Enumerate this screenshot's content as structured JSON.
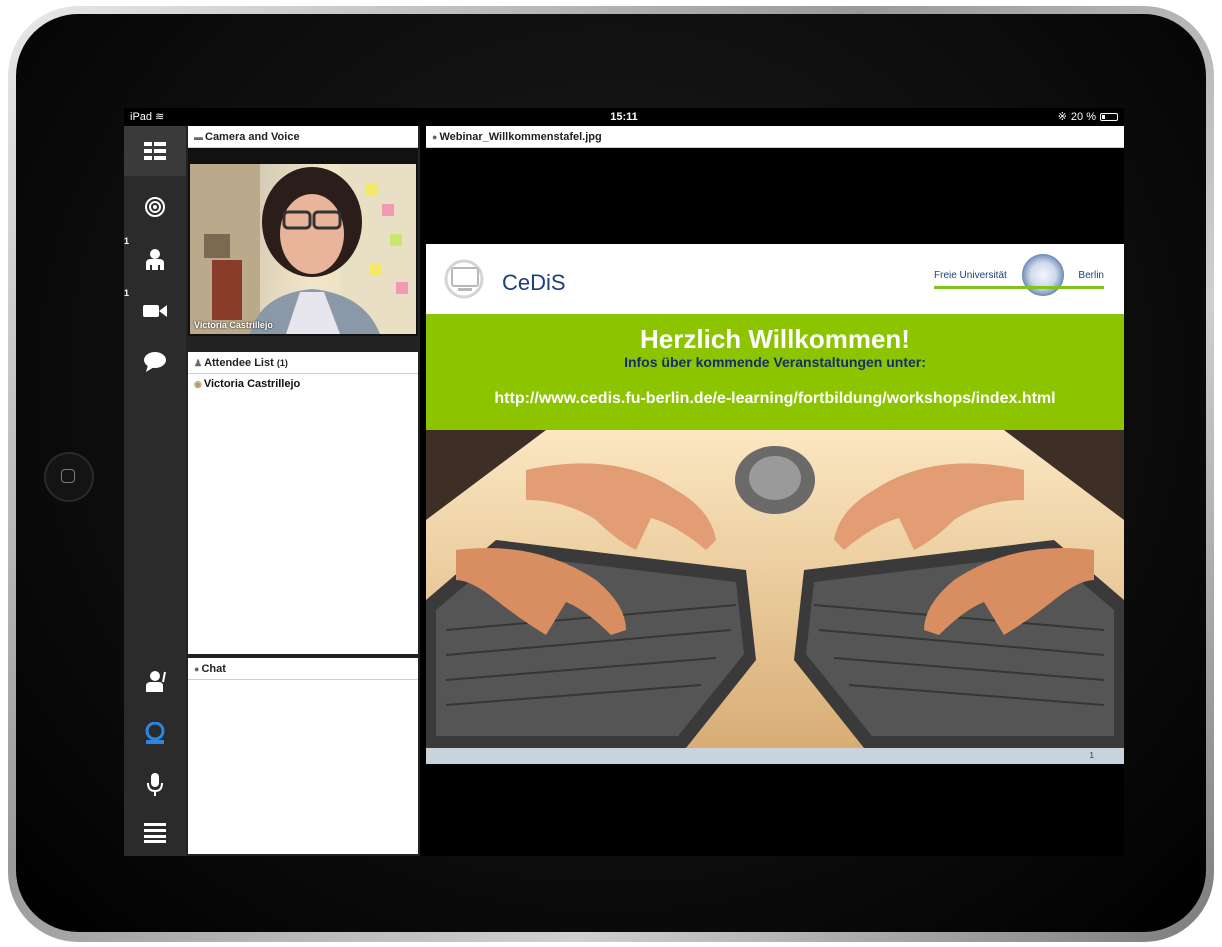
{
  "status_bar": {
    "device": "iPad",
    "time": "15:11",
    "battery": "20 %"
  },
  "sidebar": {
    "attendee_count": "1",
    "camera_count": "1"
  },
  "camera_panel": {
    "title": "Camera and Voice",
    "video_name": "Victoria Castrillejo"
  },
  "attendee_panel": {
    "title": "Attendee List",
    "count": "(1)",
    "attendees": [
      "Victoria Castrillejo"
    ]
  },
  "chat_panel": {
    "title": "Chat"
  },
  "main": {
    "file_title": "Webinar_Willkommenstafel.jpg",
    "slide": {
      "logo_text": "CeDiS",
      "university_left": "Freie Universität",
      "university_right": "Berlin",
      "headline": "Herzlich Willkommen!",
      "subline": "Infos über kommende Veranstaltungen unter:",
      "url": "http://www.cedis.fu-berlin.de/e-learning/fortbildung/workshops/index.html",
      "page_number": "1"
    }
  },
  "colors": {
    "accent_green": "#8dc400",
    "active_icon_blue": "#2b86e0",
    "iconbar_bg": "#2b2b2b"
  },
  "icons": [
    "layout-icon",
    "target-icon",
    "attendee-icon",
    "camera-icon",
    "chat-bubble-icon",
    "raise-hand-icon",
    "webcam-icon",
    "microphone-icon",
    "menu-icon"
  ]
}
